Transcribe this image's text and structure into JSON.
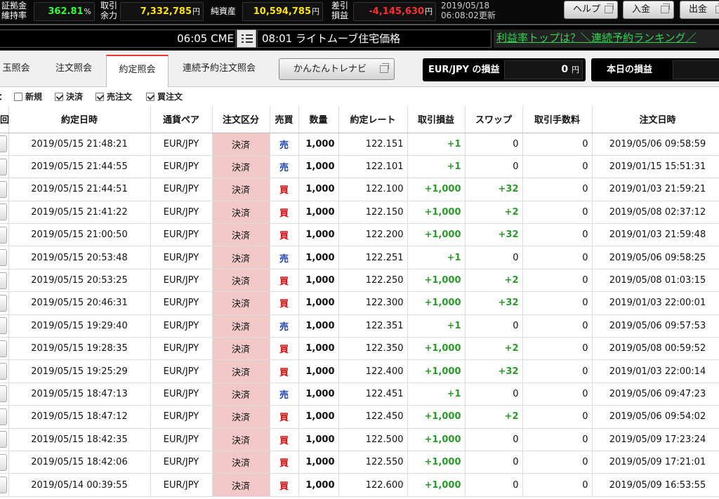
{
  "topbar": {
    "margin_label": "証拠金\n維持率",
    "margin_value": "362.81",
    "margin_unit": "%",
    "tradable_label": "取引\n余力",
    "tradable_value": "7,332,785",
    "tradable_unit": "円",
    "net_assets_label": "純資産",
    "net_assets_value": "10,594,785",
    "net_assets_unit": "円",
    "pl_label": "差引\n損益",
    "pl_value": "-4,145,630",
    "pl_unit": "円",
    "update_date": "2019/05/18",
    "update_time": "06:08:02更新",
    "help_label": "ヘルプ",
    "deposit_label": "入金",
    "withdraw_label": "出金",
    "colors": {
      "margin": "#33ff33",
      "tradable": "#ffe400",
      "net": "#ffe400",
      "pl": "#ff3030"
    }
  },
  "ticker": {
    "left_text": "06:05 CME",
    "center_text": "08:01 ライトムーブ住宅価格",
    "right_text": "利益率トップは？＼連続予約ランキング／"
  },
  "tabs": [
    {
      "label": "玉照会",
      "active": false
    },
    {
      "label": "注文照会",
      "active": false
    },
    {
      "label": "約定照会",
      "active": true
    },
    {
      "label": "連続予約注文照会",
      "active": false
    }
  ],
  "easy_button": "かんたんトレナビ",
  "pnl": {
    "pair_label": "EUR/JPY の損益",
    "pair_value": "0",
    "pair_unit": "円",
    "today_label": "本日の損益",
    "today_value": ""
  },
  "filters": {
    "partial_label": "：",
    "items": [
      {
        "label": "新規",
        "checked": false
      },
      {
        "label": "決済",
        "checked": true
      },
      {
        "label": "売注文",
        "checked": true
      },
      {
        "label": "買注文",
        "checked": true
      }
    ]
  },
  "table": {
    "headers": [
      "回",
      "約定日時",
      "通貨ペア",
      "注文区分",
      "売買",
      "数量",
      "約定レート",
      "取引損益",
      "スワップ",
      "取引手数料",
      "注文日時"
    ],
    "rows": [
      [
        "2019/05/15 21:48:21",
        "EUR/JPY",
        "決済",
        "売",
        "1,000",
        "122.151",
        "+1",
        "0",
        "0",
        "2019/05/06 09:58:59"
      ],
      [
        "2019/05/15 21:44:55",
        "EUR/JPY",
        "決済",
        "売",
        "1,000",
        "122.101",
        "+1",
        "0",
        "0",
        "2019/01/15 15:51:31"
      ],
      [
        "2019/05/15 21:44:51",
        "EUR/JPY",
        "決済",
        "買",
        "1,000",
        "122.100",
        "+1,000",
        "+32",
        "0",
        "2019/01/03 21:59:21"
      ],
      [
        "2019/05/15 21:41:22",
        "EUR/JPY",
        "決済",
        "買",
        "1,000",
        "122.150",
        "+1,000",
        "+2",
        "0",
        "2019/05/08 02:37:12"
      ],
      [
        "2019/05/15 21:00:50",
        "EUR/JPY",
        "決済",
        "買",
        "1,000",
        "122.200",
        "+1,000",
        "+32",
        "0",
        "2019/01/03 21:59:48"
      ],
      [
        "2019/05/15 20:53:48",
        "EUR/JPY",
        "決済",
        "売",
        "1,000",
        "122.251",
        "+1",
        "0",
        "0",
        "2019/05/06 09:58:25"
      ],
      [
        "2019/05/15 20:53:25",
        "EUR/JPY",
        "決済",
        "買",
        "1,000",
        "122.250",
        "+1,000",
        "+2",
        "0",
        "2019/05/08 01:03:15"
      ],
      [
        "2019/05/15 20:46:31",
        "EUR/JPY",
        "決済",
        "買",
        "1,000",
        "122.300",
        "+1,000",
        "+32",
        "0",
        "2019/01/03 22:00:01"
      ],
      [
        "2019/05/15 19:29:40",
        "EUR/JPY",
        "決済",
        "売",
        "1,000",
        "122.351",
        "+1",
        "0",
        "0",
        "2019/05/06 09:57:53"
      ],
      [
        "2019/05/15 19:28:35",
        "EUR/JPY",
        "決済",
        "買",
        "1,000",
        "122.350",
        "+1,000",
        "+2",
        "0",
        "2019/05/08 00:59:52"
      ],
      [
        "2019/05/15 19:25:29",
        "EUR/JPY",
        "決済",
        "買",
        "1,000",
        "122.400",
        "+1,000",
        "+32",
        "0",
        "2019/01/03 22:00:14"
      ],
      [
        "2019/05/15 18:47:13",
        "EUR/JPY",
        "決済",
        "売",
        "1,000",
        "122.451",
        "+1",
        "0",
        "0",
        "2019/05/06 09:47:23"
      ],
      [
        "2019/05/15 18:47:12",
        "EUR/JPY",
        "決済",
        "買",
        "1,000",
        "122.450",
        "+1,000",
        "+2",
        "0",
        "2019/05/06 09:54:02"
      ],
      [
        "2019/05/15 18:42:35",
        "EUR/JPY",
        "決済",
        "買",
        "1,000",
        "122.500",
        "+1,000",
        "0",
        "0",
        "2019/05/09 17:23:24"
      ],
      [
        "2019/05/15 18:42:06",
        "EUR/JPY",
        "決済",
        "買",
        "1,000",
        "122.550",
        "+1,000",
        "0",
        "0",
        "2019/05/09 17:21:01"
      ],
      [
        "2019/05/14 00:39:55",
        "EUR/JPY",
        "決済",
        "買",
        "1,000",
        "122.600",
        "+1,000",
        "0",
        "0",
        "2019/05/09 16:53:55"
      ]
    ]
  }
}
